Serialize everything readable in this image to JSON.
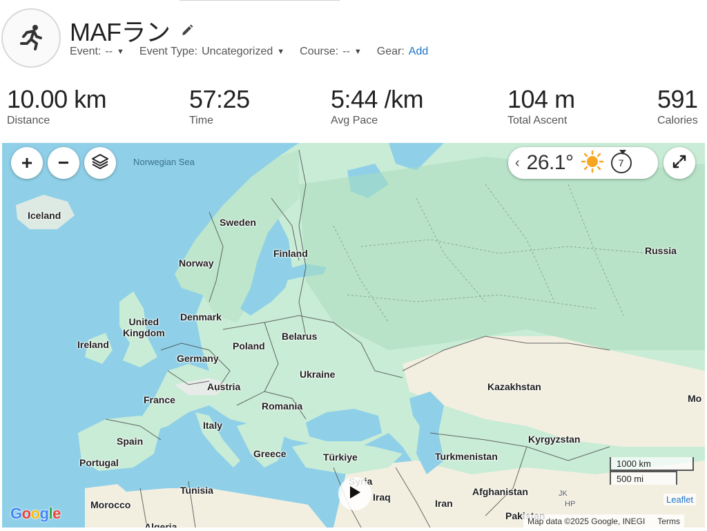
{
  "activity": {
    "title": "MAFラン",
    "event_label": "Event:",
    "event_value": "--",
    "event_type_label": "Event Type:",
    "event_type_value": "Uncategorized",
    "course_label": "Course:",
    "course_value": "--",
    "gear_label": "Gear:",
    "gear_link": "Add",
    "caret": "▼",
    "icon": "running-person-icon"
  },
  "stats": [
    {
      "value": "10.00 km",
      "label": "Distance"
    },
    {
      "value": "57:25",
      "label": "Time"
    },
    {
      "value": "5:44 /km",
      "label": "Avg Pace"
    },
    {
      "value": "104 m",
      "label": "Total Ascent"
    },
    {
      "value": "591",
      "label": "Calories"
    }
  ],
  "map": {
    "zoom_in": "+",
    "zoom_out": "−",
    "weather": {
      "temperature": "26.1°",
      "wind": "7",
      "icon": "sun-icon",
      "chevron": "‹"
    },
    "scale_km": "1000 km",
    "scale_mi": "500 mi",
    "leaflet": "Leaflet",
    "attribution": "Map data ©2025 Google, INEGI",
    "terms": "Terms",
    "google": "Google",
    "labels": {
      "norwegian_sea": "Norwegian Sea",
      "iceland": "Iceland",
      "sweden": "Sweden",
      "finland": "Finland",
      "norway": "Norway",
      "russia": "Russia",
      "denmark": "Denmark",
      "uk": "United\nKingdom",
      "ireland": "Ireland",
      "belarus": "Belarus",
      "poland": "Poland",
      "germany": "Germany",
      "ukraine": "Ukraine",
      "austria": "Austria",
      "france": "France",
      "romania": "Romania",
      "kazakhstan": "Kazakhstan",
      "mo": "Mo",
      "italy": "Italy",
      "spain": "Spain",
      "kyrgyzstan": "Kyrgyzstan",
      "portugal": "Portugal",
      "greece": "Greece",
      "turkiye": "Türkiye",
      "turkmenistan": "Turkmenistan",
      "tunisia": "Tunisia",
      "syria": "Syria",
      "iraq": "Iraq",
      "afghanistan": "Afghanistan",
      "morocco": "Morocco",
      "iran": "Iran",
      "pakistan": "Pakistan",
      "algeria": "Algeria",
      "jk": "JK",
      "hp": "HP"
    },
    "colors": {
      "water": "#8fd0e8",
      "land": "#c9ecd6",
      "forest": "#a9ddbd",
      "desert": "#f3efe0",
      "border": "#444444"
    }
  }
}
